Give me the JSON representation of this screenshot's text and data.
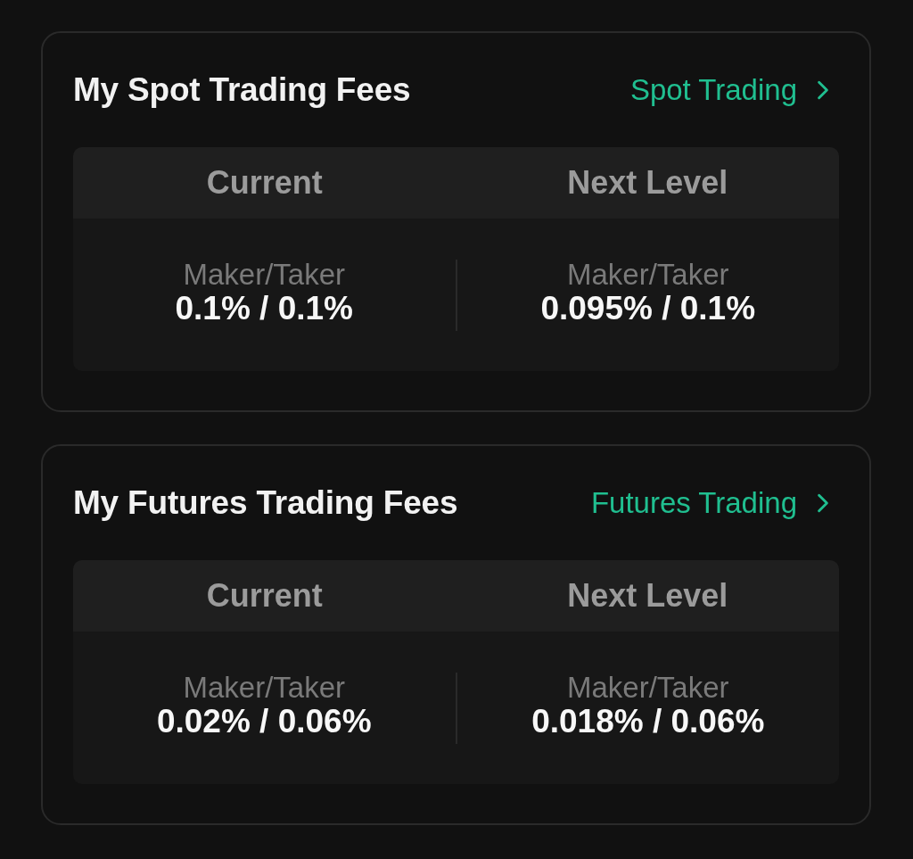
{
  "cards": [
    {
      "title": "My Spot Trading Fees",
      "link": {
        "label": "Spot Trading"
      },
      "columns": [
        {
          "heading": "Current",
          "label": "Maker/Taker",
          "value": "0.1% / 0.1%"
        },
        {
          "heading": "Next Level",
          "label": "Maker/Taker",
          "value": "0.095% / 0.1%"
        }
      ]
    },
    {
      "title": "My Futures Trading Fees",
      "link": {
        "label": "Futures Trading"
      },
      "columns": [
        {
          "heading": "Current",
          "label": "Maker/Taker",
          "value": "0.02% / 0.06%"
        },
        {
          "heading": "Next Level",
          "label": "Maker/Taker",
          "value": "0.018% / 0.06%"
        }
      ]
    }
  ]
}
